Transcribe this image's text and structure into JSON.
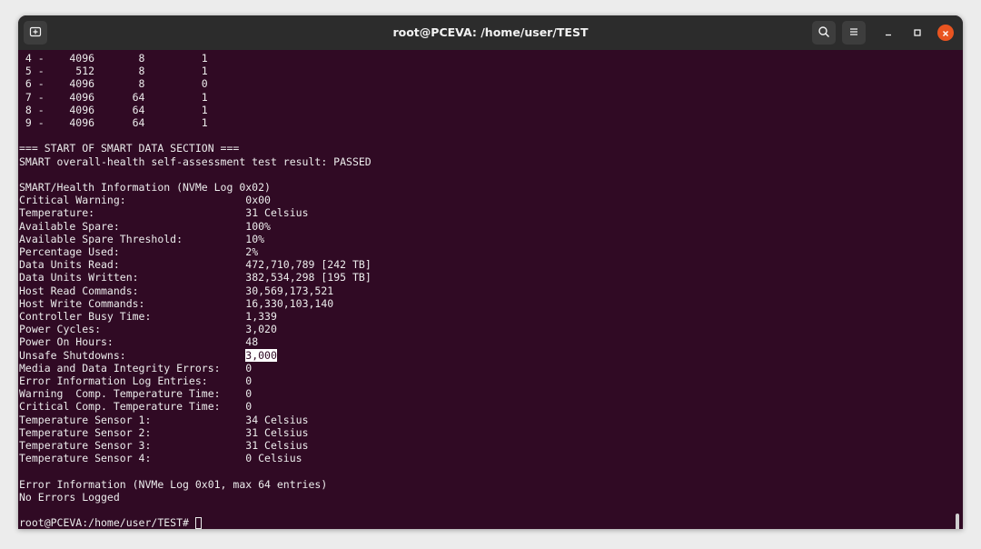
{
  "window": {
    "title": "root@PCEVA: /home/user/TEST",
    "icons": [
      "new-tab-icon",
      "search-icon",
      "hamburger-menu-icon",
      "minimize-icon",
      "maximize-icon",
      "close-icon"
    ],
    "colors": {
      "terminal_bg": "#300a24",
      "titlebar_bg": "#2c2c2c",
      "close_button": "#e95420"
    }
  },
  "terminal": {
    "lba_rows": [
      " 4 -    4096       8         1",
      " 5 -     512       8         1",
      " 6 -    4096       8         0",
      " 7 -    4096      64         1",
      " 8 -    4096      64         1",
      " 9 -    4096      64         1"
    ],
    "smart_header": "=== START OF SMART DATA SECTION ===",
    "health_result": "SMART overall-health self-assessment test result: PASSED",
    "health_info_title": "SMART/Health Information (NVMe Log 0x02)",
    "fields_before": [
      {
        "label": "Critical Warning:",
        "value": "0x00"
      },
      {
        "label": "Temperature:",
        "value": "31 Celsius"
      },
      {
        "label": "Available Spare:",
        "value": "100%"
      },
      {
        "label": "Available Spare Threshold:",
        "value": "10%"
      },
      {
        "label": "Percentage Used:",
        "value": "2%"
      },
      {
        "label": "Data Units Read:",
        "value": "472,710,789 [242 TB]"
      },
      {
        "label": "Data Units Written:",
        "value": "382,534,298 [195 TB]"
      },
      {
        "label": "Host Read Commands:",
        "value": "30,569,173,521"
      },
      {
        "label": "Host Write Commands:",
        "value": "16,330,103,140"
      },
      {
        "label": "Controller Busy Time:",
        "value": "1,339"
      },
      {
        "label": "Power Cycles:",
        "value": "3,020"
      },
      {
        "label": "Power On Hours:",
        "value": "48"
      }
    ],
    "highlighted_field": {
      "label": "Unsafe Shutdowns:",
      "value": "3,000"
    },
    "fields_after": [
      {
        "label": "Media and Data Integrity Errors:",
        "value": "0"
      },
      {
        "label": "Error Information Log Entries:",
        "value": "0"
      },
      {
        "label": "Warning  Comp. Temperature Time:",
        "value": "0"
      },
      {
        "label": "Critical Comp. Temperature Time:",
        "value": "0"
      },
      {
        "label": "Temperature Sensor 1:",
        "value": "34 Celsius"
      },
      {
        "label": "Temperature Sensor 2:",
        "value": "31 Celsius"
      },
      {
        "label": "Temperature Sensor 3:",
        "value": "31 Celsius"
      },
      {
        "label": "Temperature Sensor 4:",
        "value": "0 Celsius"
      }
    ],
    "error_info_title": "Error Information (NVMe Log 0x01, max 64 entries)",
    "error_info_result": "No Errors Logged",
    "prompt": "root@PCEVA:/home/user/TEST# "
  }
}
